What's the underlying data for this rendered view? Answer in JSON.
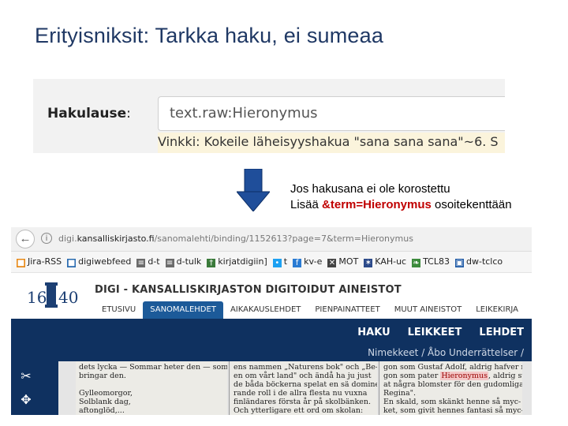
{
  "slide": {
    "title": "Erityisniksit: Tarkka haku, ei sumeaa"
  },
  "search": {
    "label": "Hakulause",
    "label_suffix": ":",
    "query": "text.raw:Hieronymus",
    "hint": "Vinkki: Kokeile läheisyyshakua \"sana sana sana\"~6. S"
  },
  "note": {
    "line1": "Jos hakusana ei ole korostettu",
    "line2_prefix": "Lisää ",
    "line2_param": "&term=Hieronymus",
    "line2_suffix": " osoitekenttään"
  },
  "browser": {
    "url_host_prefix": "digi.",
    "url_host": "kansalliskirjasto.fi",
    "url_path": "/sanomalehti/binding/1152613?page=7&term=Hieronymus",
    "bookmarks": [
      {
        "label": "Jira-RSS",
        "icon": "rss-icon",
        "color": "#e88b1a"
      },
      {
        "label": "digiwebfeed",
        "icon": "feed-icon",
        "color": "#2b6cb0"
      },
      {
        "label": "d-t",
        "icon": "pillar-icon",
        "color": "#6b6b6b"
      },
      {
        "label": "d-tulk",
        "icon": "pillar-icon",
        "color": "#6b6b6b"
      },
      {
        "label": "kirjatdigiin]",
        "icon": "tree-icon",
        "color": "#3a7a3a"
      },
      {
        "label": "t",
        "icon": "twitter-icon",
        "color": "#1da1f2"
      },
      {
        "label": "kv-e",
        "icon": "f-icon",
        "color": "#2a7bd3"
      },
      {
        "label": "MOT",
        "icon": "cross-icon",
        "color": "#444444"
      },
      {
        "label": "KAH-uc",
        "icon": "star-cross-icon",
        "color": "#2c4a8a"
      },
      {
        "label": "TCL83",
        "icon": "leaf-icon",
        "color": "#3d8b3d"
      },
      {
        "label": "dw-tclco",
        "icon": "box-icon",
        "color": "#1f5aa6"
      }
    ],
    "site_title": "DIGI - KANSALLISKIRJASTON DIGITOIDUT AINEISTOT",
    "logo_text_left": "16",
    "logo_text_right": "40",
    "nav_tabs": [
      {
        "label": "ETUSIVU",
        "active": false
      },
      {
        "label": "SANOMALEHDET",
        "active": true
      },
      {
        "label": "AIKAKAUSLEHDET",
        "active": false
      },
      {
        "label": "PIENPAINATTEET",
        "active": false
      },
      {
        "label": "MUUT AINEISTOT",
        "active": false
      },
      {
        "label": "LEIKEKIRJA",
        "active": false
      }
    ],
    "navbar_links": [
      "HAKU",
      "LEIKKEET",
      "LEHDET"
    ],
    "breadcrumb": "Nimekkeet /  Åbo Underrättelser /",
    "scan_columns": [
      {
        "lines": [
          "dets lycka — Sommar heter den — som",
          "bringar den.",
          "",
          "Gylleomorgor,",
          "Solblank dag,",
          "aftonglöd,..."
        ]
      },
      {
        "lines": [
          "ens nammen „Naturens bok\" och „Be-",
          "en om vårt land\" och ändå ha ju just",
          "de båda böckerna spelat en sä domine-",
          "rande roll i de allra flesta nu vuxna",
          "finländares första år på skolbänken.",
          "Och ytterligare ett ord om skolan:"
        ]
      },
      {
        "lines_before": [
          "gon som Gustaf Adolf, aldrig hafver när-",
          "gon som pater "
        ],
        "highlight": "Hieronymus",
        "lines_after_inline": ", aldrig sväng-",
        "lines": [
          "at några blomster för den gudomliga",
          "Regina\".",
          "En skald, som skänkt henne så myc-",
          "ket, som givit hennes fantasi så myc-"
        ]
      }
    ]
  },
  "colors": {
    "title": "#1f3864",
    "navbar": "#0f3160",
    "active_tab": "#1c5a99",
    "arrow": "#1f4e9a",
    "highlight_text": "#c00000"
  }
}
